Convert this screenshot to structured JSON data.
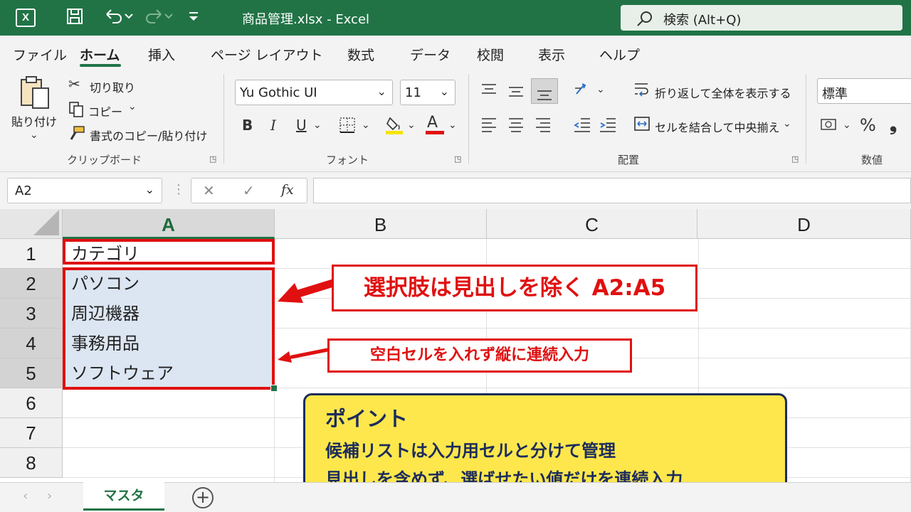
{
  "window": {
    "logo": "X",
    "title": "商品管理.xlsx  -  Excel",
    "search": "検索 (Alt+Q)"
  },
  "menu": {
    "tabs": [
      "ファイル",
      "ホーム",
      "挿入",
      "ページ レイアウト",
      "数式",
      "データ",
      "校閲",
      "表示",
      "ヘルプ"
    ],
    "active": "ホーム"
  },
  "ribbon": {
    "clipboard": {
      "paste": "貼り付け",
      "cut": "切り取り",
      "copy": "コピー",
      "format_painter": "書式のコピー/貼り付け",
      "group_label": "クリップボード"
    },
    "font": {
      "font_name": "Yu Gothic UI",
      "font_size": "11",
      "bold": "B",
      "italic": "I",
      "underline": "U",
      "font_color_letter": "A",
      "group_label": "フォント"
    },
    "alignment": {
      "wrap_text": "折り返して全体を表示する",
      "merge_center": "セルを結合して中央揃え",
      "group_label": "配置"
    },
    "number": {
      "format": "標準",
      "percent": "%",
      "comma": "❟",
      "group_label": "数値"
    }
  },
  "formula_bar": {
    "name_box": "A2",
    "fx": "fx",
    "content": ""
  },
  "grid": {
    "columns": [
      "A",
      "B",
      "C",
      "D"
    ],
    "rows": [
      "1",
      "2",
      "3",
      "4",
      "5",
      "6",
      "7",
      "8"
    ],
    "cells": {
      "A1": "カテゴリ",
      "A2": "パソコン",
      "A3": "周辺機器",
      "A4": "事務用品",
      "A5": "ソフトウェア"
    }
  },
  "callouts": {
    "selection": "選択肢は見出しを除く A2:A5",
    "no_blank": "空白セルを入れず縦に連続入力"
  },
  "point": {
    "title": "ポイント",
    "line1": "候補リストは入力用セルと分けて管理",
    "line2": "見出しを含めず、選ばせたい値だけを連続入力"
  },
  "sheets": {
    "tabs": [
      "マスタ"
    ],
    "add": "+"
  },
  "colors": {
    "excel_green": "#217346",
    "annotation_red": "#e01010",
    "selection_fill": "#dce6f2",
    "point_yellow": "#fde74c",
    "point_navy": "#1c2c5c"
  }
}
